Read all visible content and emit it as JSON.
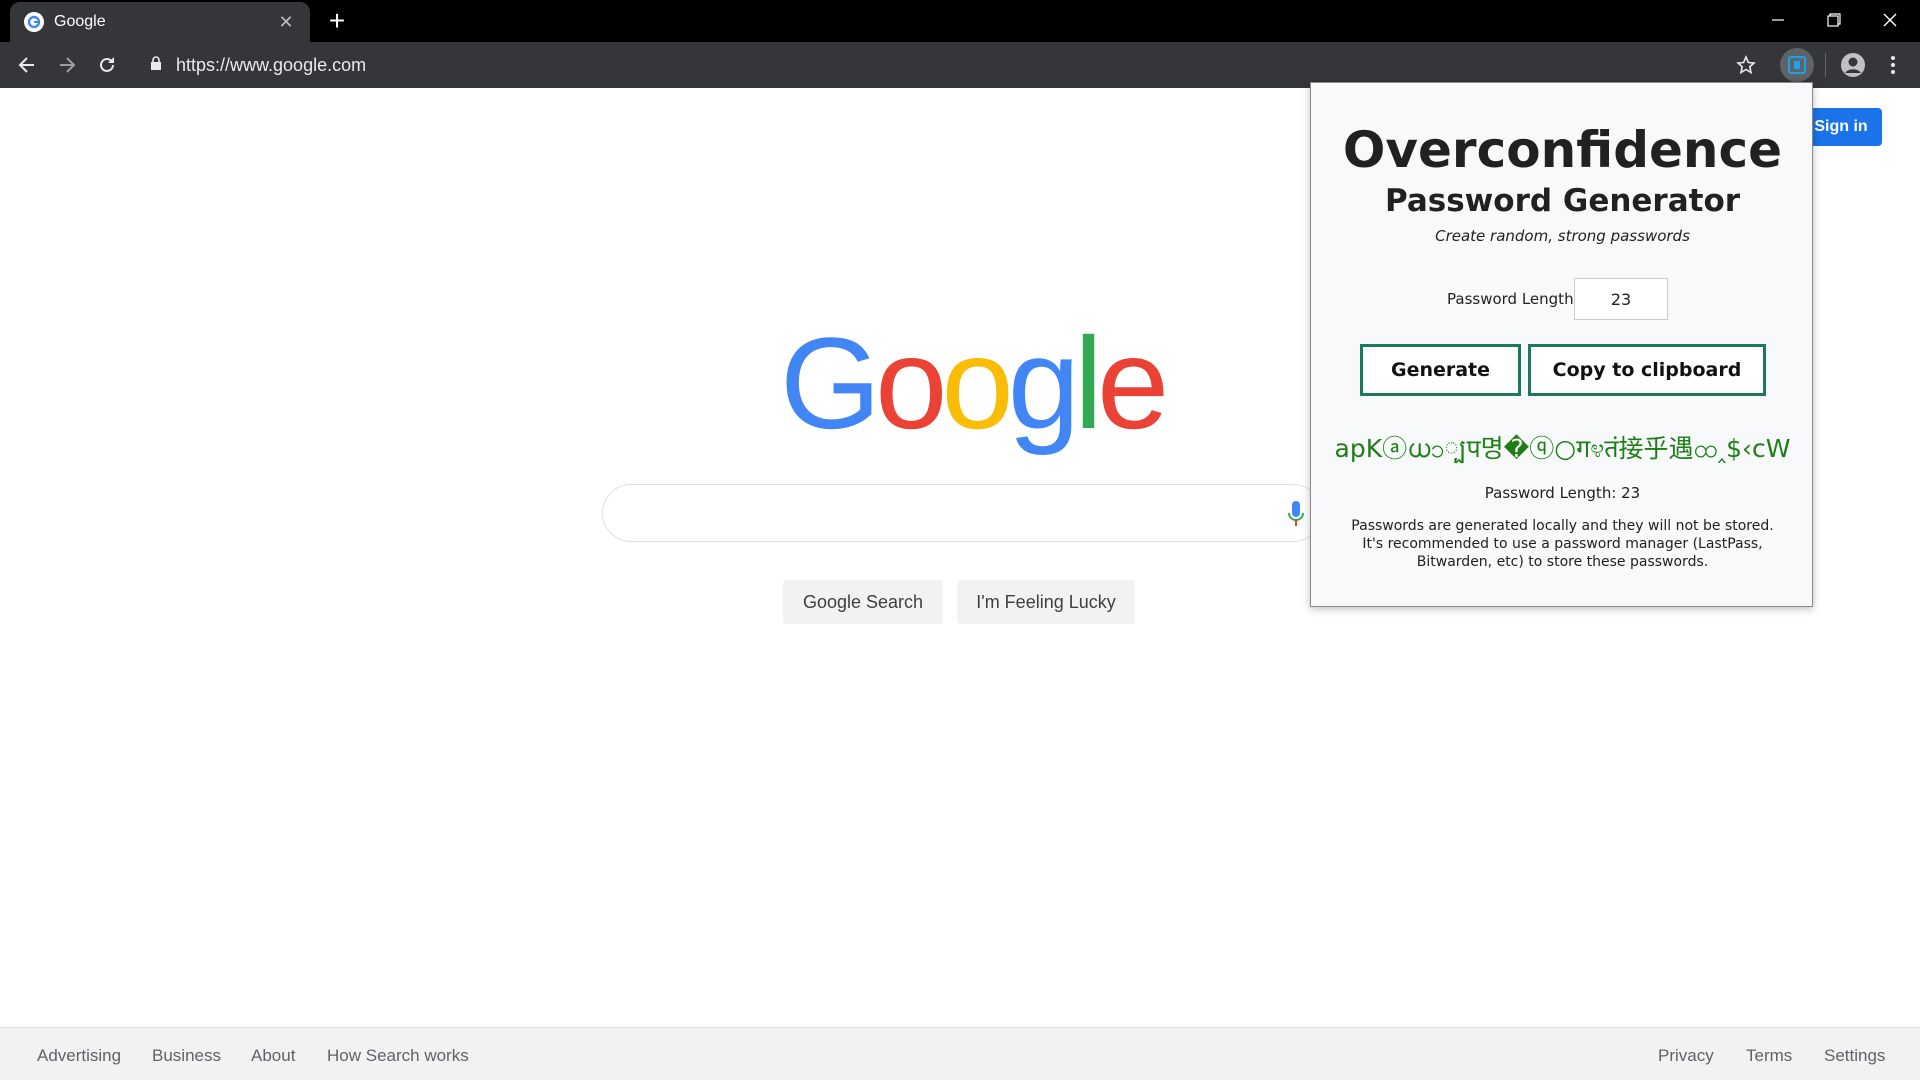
{
  "browser": {
    "tab_title": "Google",
    "tab_close": "✕",
    "new_tab": "+",
    "url": "https://www.google.com"
  },
  "page": {
    "sign_in": "Sign in",
    "logo_letters": [
      "G",
      "o",
      "o",
      "g",
      "l",
      "e"
    ],
    "logo_colors": [
      "#4285f4",
      "#ea4335",
      "#fbbc05",
      "#4285f4",
      "#34a853",
      "#ea4335"
    ],
    "search_button": "Google Search",
    "lucky_button": "I'm Feeling Lucky",
    "footer_left": [
      "Advertising",
      "Business",
      "About",
      "How Search works"
    ],
    "footer_right": [
      "Privacy",
      "Terms",
      "Settings"
    ]
  },
  "popup": {
    "title": "Overconfidence",
    "subtitle": "Password Generator",
    "tagline": "Create random, strong passwords",
    "length_label": "Password Length",
    "length_value": "23",
    "generate_button": "Generate",
    "copy_button": "Copy to clipboard",
    "password": "apKⓐധၥ្បप명�ⓠ○ग೪तं接乎遇ထ‸$‹cW",
    "length_display": "Password Length: 23",
    "note_line1": "Passwords are generated locally and they will not be stored.",
    "note_line2": "It's recommended to use a password manager (LastPass, Bitwarden, etc) to store these passwords."
  },
  "colors": {
    "tab_bg": "#35363a",
    "signin_blue": "#1a73e8",
    "button_border": "#1a7a5a",
    "password_green": "#1e7e16"
  }
}
